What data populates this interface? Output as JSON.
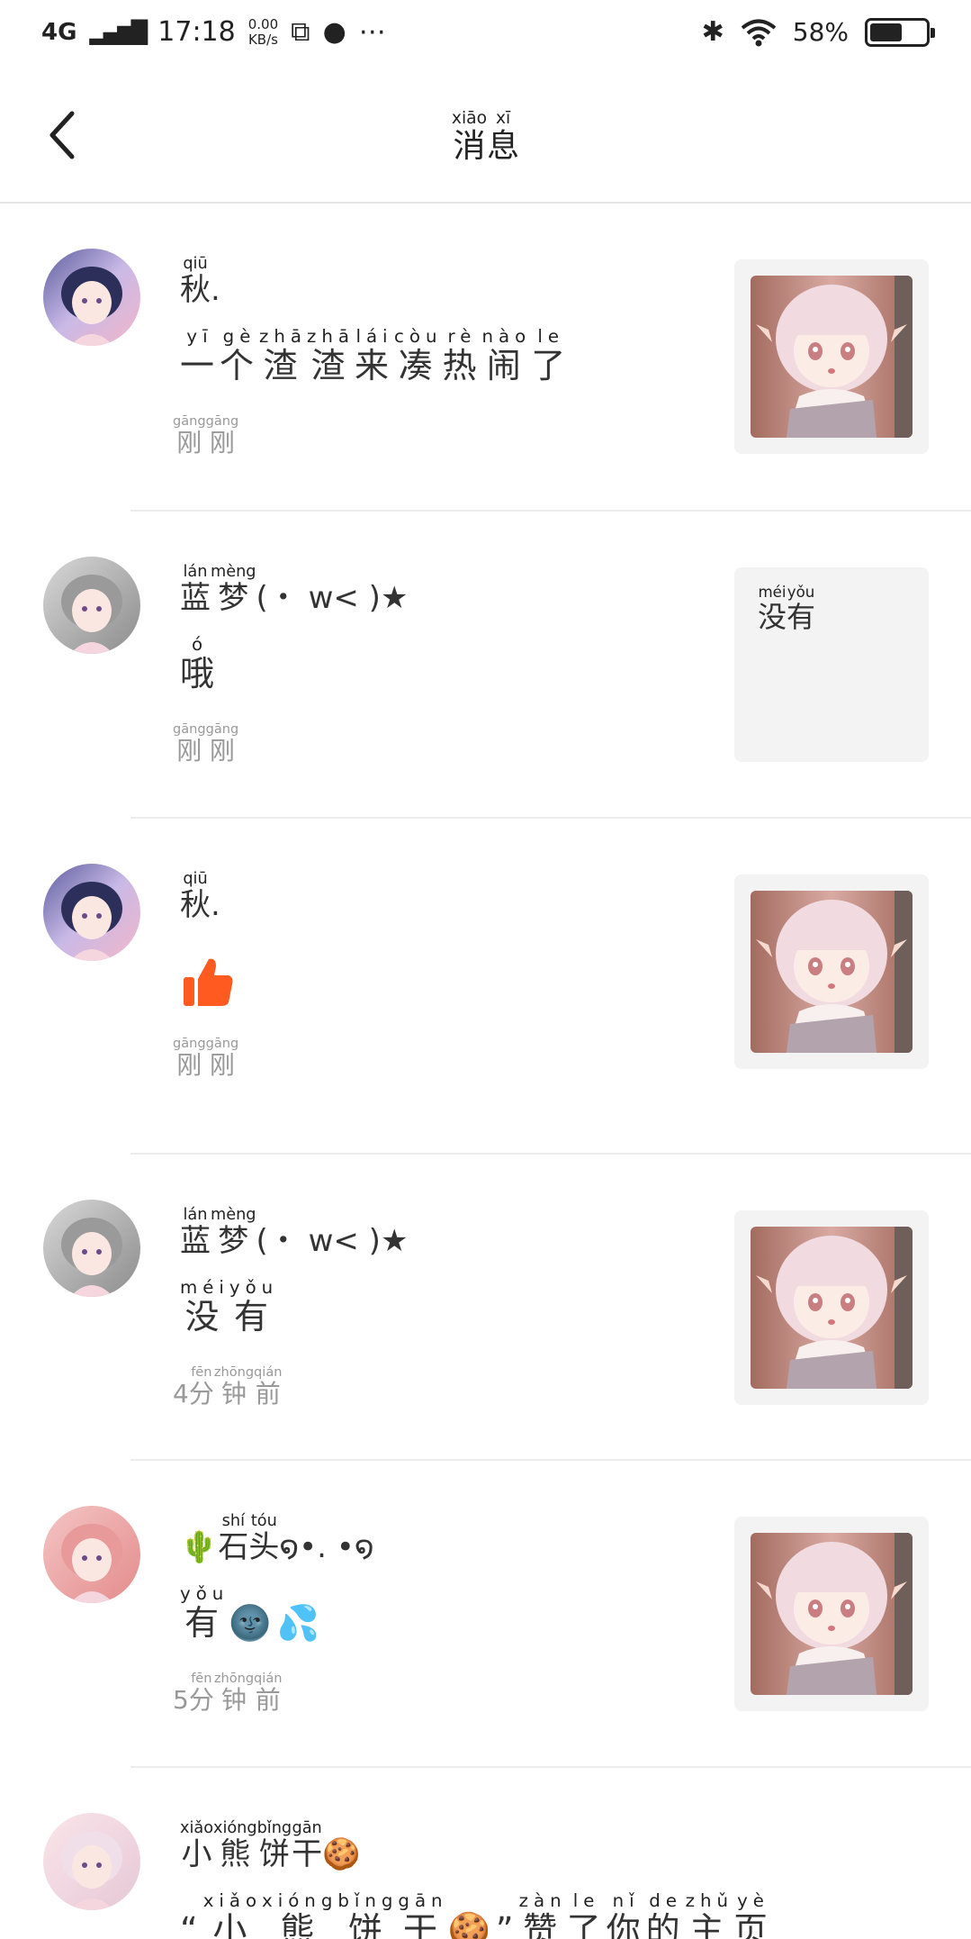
{
  "status_bar": {
    "network": "4G",
    "time": "17:18",
    "speed_value": "0.00",
    "speed_unit": "KB/s",
    "battery_percent": "58%",
    "battery_level": 0.58
  },
  "header": {
    "title_chars": [
      {
        "char": "消",
        "py": "xiāo"
      },
      {
        "char": "息",
        "py": "xī"
      }
    ]
  },
  "messages": [
    {
      "name": [
        {
          "char": "秋",
          "py": "qiū"
        },
        {
          "char": ".",
          "py": ""
        }
      ],
      "text": [
        {
          "char": "一",
          "py": "yī"
        },
        {
          "char": "个",
          "py": "gè"
        },
        {
          "char": "渣",
          "py": "zhā"
        },
        {
          "char": "渣",
          "py": "zhā"
        },
        {
          "char": "来",
          "py": "lái"
        },
        {
          "char": "凑",
          "py": "còu"
        },
        {
          "char": "热",
          "py": "rè"
        },
        {
          "char": "闹",
          "py": "nào"
        },
        {
          "char": "了",
          "py": "le"
        }
      ],
      "time": [
        {
          "char": "刚",
          "py": "gāng"
        },
        {
          "char": "刚",
          "py": "gāng"
        }
      ],
      "thumb_kind": "image"
    },
    {
      "name": [
        {
          "char": "蓝",
          "py": "lán"
        },
        {
          "char": "梦",
          "py": "mèng"
        },
        {
          "char": "(・ w< )★",
          "py": ""
        }
      ],
      "text": [
        {
          "char": "哦",
          "py": "ó"
        }
      ],
      "time": [
        {
          "char": "刚",
          "py": "gāng"
        },
        {
          "char": "刚",
          "py": "gāng"
        }
      ],
      "thumb_kind": "text",
      "thumb_text": [
        {
          "char": "没",
          "py": "méi"
        },
        {
          "char": "有",
          "py": "yǒu"
        }
      ]
    },
    {
      "name": [
        {
          "char": "秋",
          "py": "qiū"
        },
        {
          "char": ".",
          "py": ""
        }
      ],
      "text_kind": "thumbs-up",
      "time": [
        {
          "char": "刚",
          "py": "gāng"
        },
        {
          "char": "刚",
          "py": "gāng"
        }
      ],
      "thumb_kind": "image"
    },
    {
      "name": [
        {
          "char": "蓝",
          "py": "lán"
        },
        {
          "char": "梦",
          "py": "mèng"
        },
        {
          "char": "(・ w< )★",
          "py": ""
        }
      ],
      "text": [
        {
          "char": "没",
          "py": "méi"
        },
        {
          "char": "有",
          "py": "yǒu"
        }
      ],
      "time": [
        {
          "char": "4",
          "py": ""
        },
        {
          "char": "分",
          "py": "fēn"
        },
        {
          "char": "钟",
          "py": "zhōng"
        },
        {
          "char": "前",
          "py": "qián"
        }
      ],
      "thumb_kind": "image"
    },
    {
      "name": [
        {
          "char": "🌵",
          "py": ""
        },
        {
          "char": "石",
          "py": "shí"
        },
        {
          "char": "头",
          "py": "tóu"
        },
        {
          "char": "໑•. •໑",
          "py": ""
        }
      ],
      "text": [
        {
          "char": "有",
          "py": "yǒu"
        },
        {
          "char": "🌚💦",
          "py": ""
        }
      ],
      "time": [
        {
          "char": "5",
          "py": ""
        },
        {
          "char": "分",
          "py": "fēn"
        },
        {
          "char": "钟",
          "py": "zhōng"
        },
        {
          "char": "前",
          "py": "qián"
        }
      ],
      "thumb_kind": "image"
    },
    {
      "name": [
        {
          "char": "小",
          "py": "xiǎo"
        },
        {
          "char": "熊",
          "py": "xióng"
        },
        {
          "char": "饼",
          "py": "bǐng"
        },
        {
          "char": "干",
          "py": "gān"
        },
        {
          "char": "🍪",
          "py": ""
        }
      ],
      "text": [
        {
          "char": "“",
          "py": ""
        },
        {
          "char": "小",
          "py": "xiǎo"
        },
        {
          "char": "熊",
          "py": "xióng"
        },
        {
          "char": "饼",
          "py": "bǐng"
        },
        {
          "char": "干",
          "py": "gān"
        },
        {
          "char": "🍪”",
          "py": ""
        },
        {
          "char": "赞",
          "py": "zàn"
        },
        {
          "char": "了",
          "py": "le"
        },
        {
          "char": "你",
          "py": "nǐ"
        },
        {
          "char": "的",
          "py": "de"
        },
        {
          "char": "主",
          "py": "zhǔ"
        },
        {
          "char": "页",
          "py": "yè"
        }
      ],
      "time": [],
      "thumb_kind": "none"
    }
  ]
}
